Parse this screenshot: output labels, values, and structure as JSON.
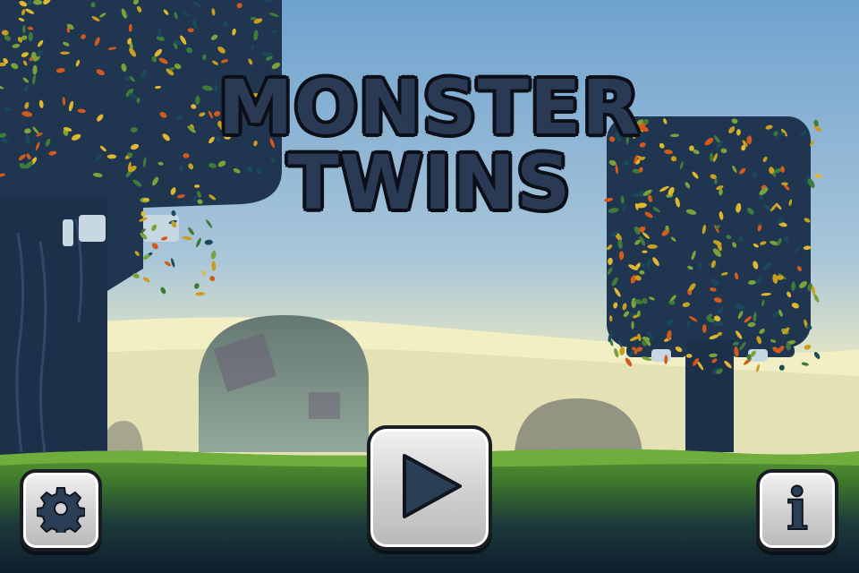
{
  "game": {
    "title_line1": "MONSTER",
    "title_line2": "TWINS"
  },
  "buttons": {
    "settings_icon": "gear-icon",
    "play_icon": "play-icon",
    "info_icon": "info-icon",
    "info_glyph": "i"
  },
  "colors": {
    "sky_top": "#6fa2cf",
    "sky_bottom": "#e9ecc9",
    "title_fill": "#2a3a55",
    "tree_dark": "#1f3550",
    "grass": "#4f8a2e",
    "button_face": "#d9d9d9",
    "icon_color": "#2a3e55"
  }
}
